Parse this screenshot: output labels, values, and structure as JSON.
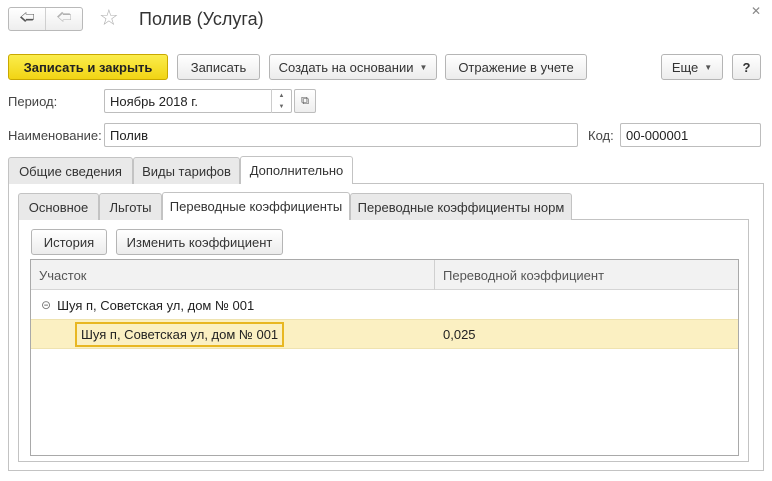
{
  "window": {
    "title": "Полив (Услуга)"
  },
  "toolbar": {
    "save_close": "Записать и закрыть",
    "save": "Записать",
    "create_based_on": "Создать на основании",
    "accounting": "Отражение в учете",
    "more": "Еще",
    "help": "?"
  },
  "fields": {
    "period_label": "Период:",
    "period_value": "Ноябрь 2018 г.",
    "name_label": "Наименование:",
    "name_value": "Полив",
    "code_label": "Код:",
    "code_value": "00-000001"
  },
  "tabs": {
    "top": [
      "Общие сведения",
      "Виды тарифов",
      "Дополнительно"
    ],
    "inner": [
      "Основное",
      "Льготы",
      "Переводные коэффициенты",
      "Переводные коэффициенты норм"
    ]
  },
  "panel_buttons": {
    "history": "История",
    "change_coef": "Изменить коэффициент"
  },
  "table": {
    "columns": [
      "Участок",
      "Переводной коэффициент"
    ],
    "group": "Шуя п, Советская ул, дом № 001",
    "rows": [
      {
        "site": "Шуя п, Советская ул, дом № 001",
        "coef": "0,025"
      }
    ]
  }
}
